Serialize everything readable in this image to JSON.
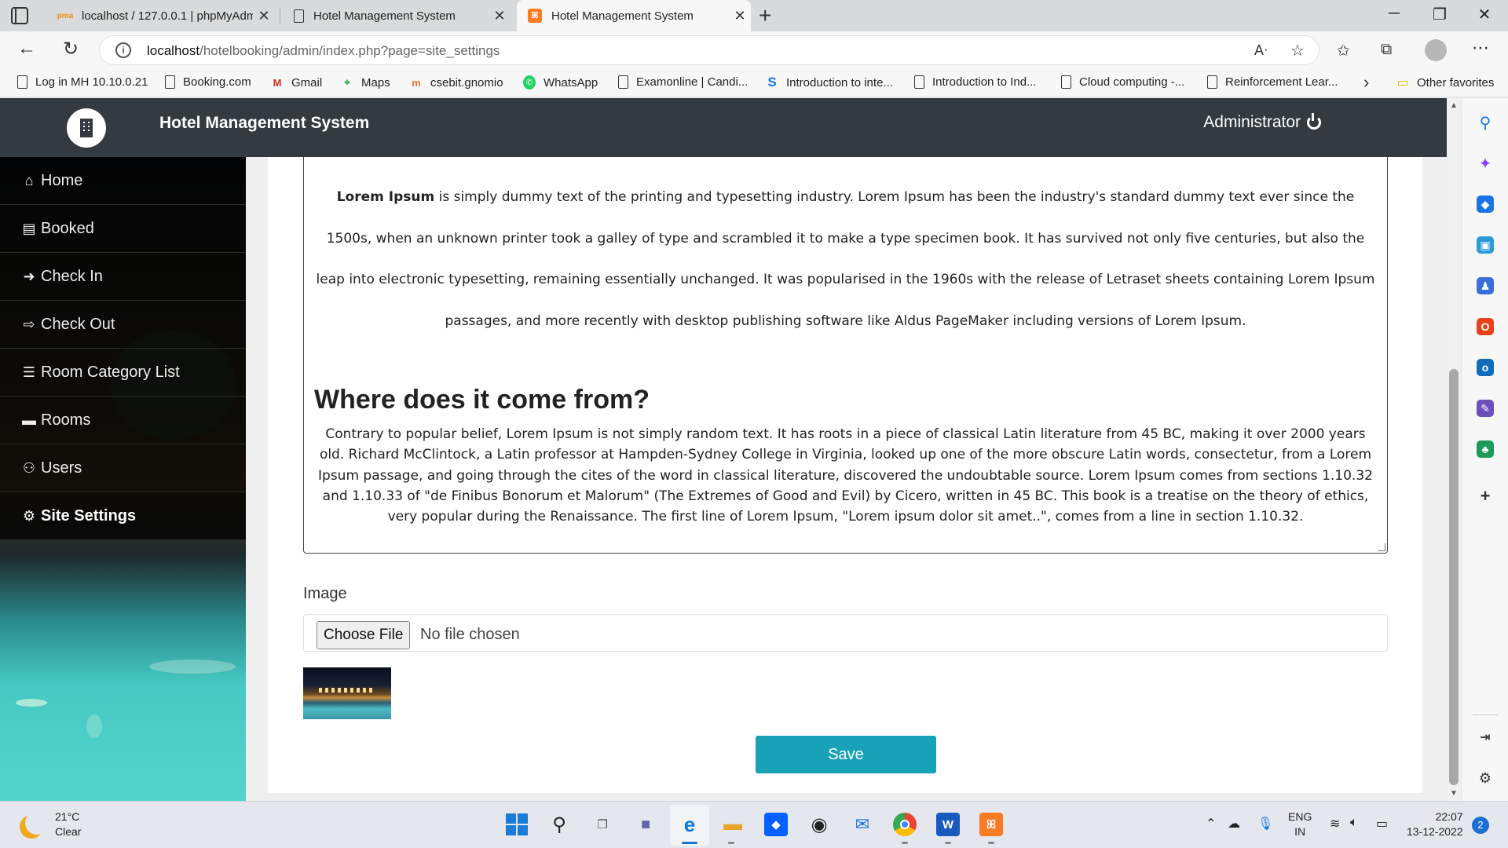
{
  "browser": {
    "tabs": [
      {
        "title": "localhost / 127.0.0.1 | phpMyAdm",
        "favicon": "phpmyadmin-icon"
      },
      {
        "title": "Hotel Management System",
        "favicon": "page-icon"
      },
      {
        "title": "Hotel Management System",
        "favicon": "xampp-icon",
        "active": true
      }
    ],
    "url_host": "localhost",
    "url_path": "/hotelbooking/admin/index.php?page=site_settings",
    "bookmarks": [
      {
        "label": "Log in MH 10.10.0.21",
        "icon": "page-icon"
      },
      {
        "label": "Booking.com",
        "icon": "page-icon"
      },
      {
        "label": "Gmail",
        "icon": "gmail-icon"
      },
      {
        "label": "Maps",
        "icon": "maps-icon"
      },
      {
        "label": "csebit.gnomio",
        "icon": "moodle-icon"
      },
      {
        "label": "WhatsApp",
        "icon": "whatsapp-icon"
      },
      {
        "label": "Examonline | Candi...",
        "icon": "page-icon"
      },
      {
        "label": "Introduction to inte...",
        "icon": "s-icon"
      },
      {
        "label": "Introduction to Ind...",
        "icon": "page-icon"
      },
      {
        "label": "Cloud computing -...",
        "icon": "page-icon"
      },
      {
        "label": "Reinforcement Lear...",
        "icon": "page-icon"
      }
    ],
    "other_favorites": "Other favorites"
  },
  "app": {
    "brand": "Hotel Management System",
    "user": "Administrator",
    "menu": [
      {
        "label": "Home",
        "icon": "home-icon"
      },
      {
        "label": "Booked",
        "icon": "book-icon"
      },
      {
        "label": "Check In",
        "icon": "sign-in-icon"
      },
      {
        "label": "Check Out",
        "icon": "sign-out-icon"
      },
      {
        "label": "Room Category List",
        "icon": "list-icon"
      },
      {
        "label": "Rooms",
        "icon": "bed-icon"
      },
      {
        "label": "Users",
        "icon": "users-icon"
      },
      {
        "label": "Site Settings",
        "icon": "cogs-icon",
        "active": true
      }
    ]
  },
  "content": {
    "lorem_bold": "Lorem Ipsum",
    "lorem_text": " is simply dummy text of the printing and typesetting industry. Lorem Ipsum has been the industry's standard dummy text ever since the 1500s, when an unknown printer took a galley of type and scrambled it to make a type specimen book. It has survived not only five centuries, but also the leap into electronic typesetting, remaining essentially unchanged. It was popularised in the 1960s with the release of Letraset sheets containing Lorem Ipsum passages, and more recently with desktop publishing software like Aldus PageMaker including versions of Lorem Ipsum.",
    "heading": "Where does it come from?",
    "where_text": "Contrary to popular belief, Lorem Ipsum is not simply random text. It has roots in a piece of classical Latin literature from 45 BC, making it over 2000 years old. Richard McClintock, a Latin professor at Hampden-Sydney College in Virginia, looked up one of the more obscure Latin words, consectetur, from a Lorem Ipsum passage, and going through the cites of the word in classical literature, discovered the undoubtable source. Lorem Ipsum comes from sections 1.10.32 and 1.10.33 of \"de Finibus Bonorum et Malorum\" (The Extremes of Good and Evil) by Cicero, written in 45 BC. This book is a treatise on the theory of ethics, very popular during the Renaissance. The first line of Lorem Ipsum, \"Lorem ipsum dolor sit amet..\", comes from a line in section 1.10.32.",
    "image_label": "Image",
    "choose_file": "Choose File",
    "no_file": "No file chosen",
    "save": "Save"
  },
  "taskbar": {
    "temperature": "21°C",
    "condition": "Clear",
    "lang_top": "ENG",
    "lang_bottom": "IN",
    "time": "22:07",
    "date": "13-12-2022",
    "notifications": "2"
  },
  "colors": {
    "topnav": "#343a40",
    "save_button": "#17a2b8"
  }
}
